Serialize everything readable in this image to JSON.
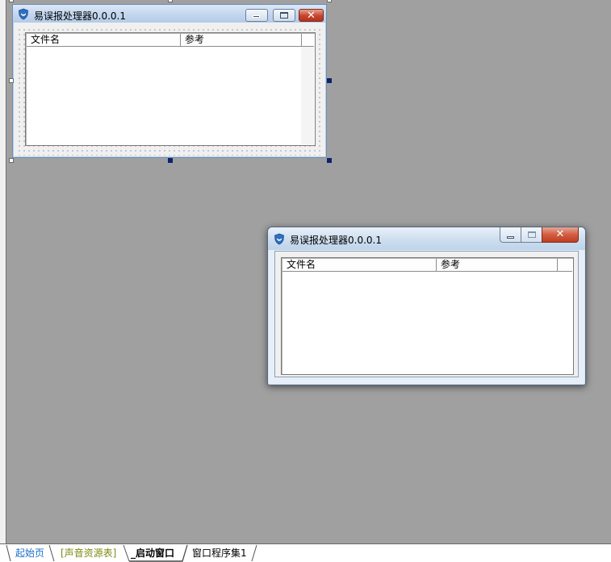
{
  "designer": {
    "design_form": {
      "title": "易误报处理器0.0.0.1",
      "listview": {
        "columns": [
          "文件名",
          "参考"
        ]
      }
    },
    "runtime_form": {
      "title": "易误报处理器0.0.0.1",
      "listview": {
        "columns": [
          "文件名",
          "参考"
        ]
      }
    }
  },
  "tabs": [
    {
      "label": "起始页",
      "color": "#1a6fc8"
    },
    {
      "label": "[声音资源表]",
      "color": "#7d8a12"
    },
    {
      "label": "_启动窗口",
      "color": "#000000",
      "active": true
    },
    {
      "label": "窗口程序集1",
      "color": "#000000"
    }
  ],
  "icons": {
    "window_icon": "shield-icon",
    "minimize": "minimize-icon",
    "maximize": "maximize-icon",
    "close": "close-icon"
  },
  "colors": {
    "workspace": "#a0a0a0",
    "titlebar": "#c2d6ee",
    "close_button": "#c6432d",
    "selection_handle": "#0a246a"
  }
}
